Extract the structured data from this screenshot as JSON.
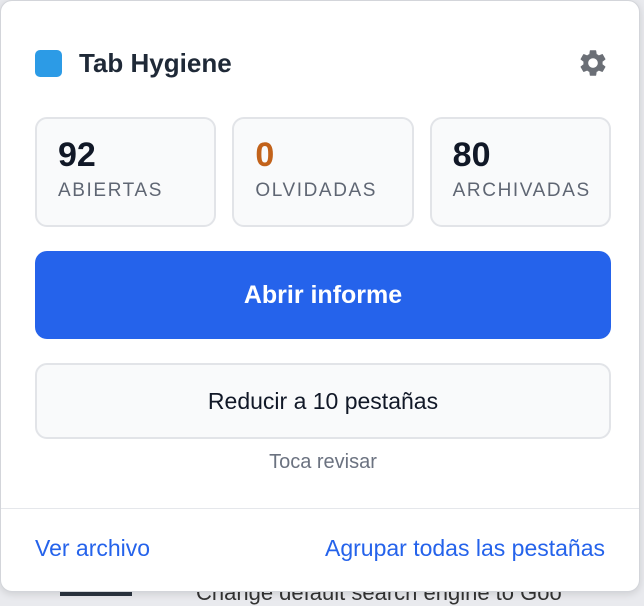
{
  "app": {
    "title": "Tab Hygiene",
    "brand_color": "#2c9be6",
    "settings_icon": "gear-icon"
  },
  "stats": [
    {
      "value": "92",
      "label": "ABIERTAS",
      "color": "#111827"
    },
    {
      "value": "0",
      "label": "OLVIDADAS",
      "color": "#c2621a"
    },
    {
      "value": "80",
      "label": "ARCHIVADAS",
      "color": "#111827"
    }
  ],
  "actions": {
    "primary_label": "Abrir informe",
    "secondary_label": "Reducir a 10 pestañas",
    "hint": "Toca revisar"
  },
  "footer": {
    "left_link": "Ver archivo",
    "right_link": "Agrupar todas las pestañas"
  },
  "background": {
    "partial_text": "Change default search engine to Goo"
  },
  "colors": {
    "accent": "#2563eb"
  }
}
